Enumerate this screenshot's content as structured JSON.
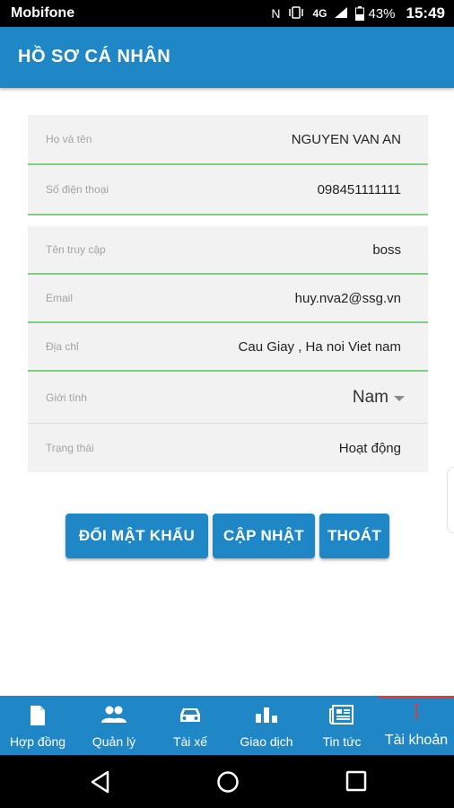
{
  "status_bar": {
    "carrier": "Mobifone",
    "network": "4G",
    "battery": "43%",
    "time": "15:49"
  },
  "header": {
    "title": "HỒ SƠ CÁ NHÂN"
  },
  "profile_form": {
    "full_name": {
      "label": "Họ và tên",
      "value": "NGUYEN VAN AN"
    },
    "phone": {
      "label": "Số điện thoại",
      "value": "098451111111"
    },
    "username": {
      "label": "Tên truy cập",
      "value": "boss"
    },
    "email": {
      "label": "Email",
      "value": "huy.nva2@ssg.vn"
    },
    "address": {
      "label": "Địa chỉ",
      "value": "Cau Giay , Ha noi Viet nam"
    },
    "gender": {
      "label": "Giới tính",
      "value": "Nam"
    },
    "status": {
      "label": "Trạng thái",
      "value": "Hoạt động"
    }
  },
  "actions": {
    "change_password": "ĐỔI MẬT KHẨU",
    "update": "CẬP NHẬT",
    "logout": "THOÁT"
  },
  "bottom_nav": {
    "items": [
      {
        "label": "Hợp đồng",
        "icon": "document-icon"
      },
      {
        "label": "Quản lý",
        "icon": "people-icon"
      },
      {
        "label": "Tài xế",
        "icon": "car-icon"
      },
      {
        "label": "Giao dịch",
        "icon": "bar-chart-icon"
      },
      {
        "label": "Tin tức",
        "icon": "newspaper-icon"
      },
      {
        "label": "Tài khoản",
        "icon": "info-icon",
        "active": true
      }
    ]
  },
  "colors": {
    "primary": "#1f87c6",
    "active_field_border": "#7ed07e",
    "active_tab_indicator": "#e53935"
  }
}
